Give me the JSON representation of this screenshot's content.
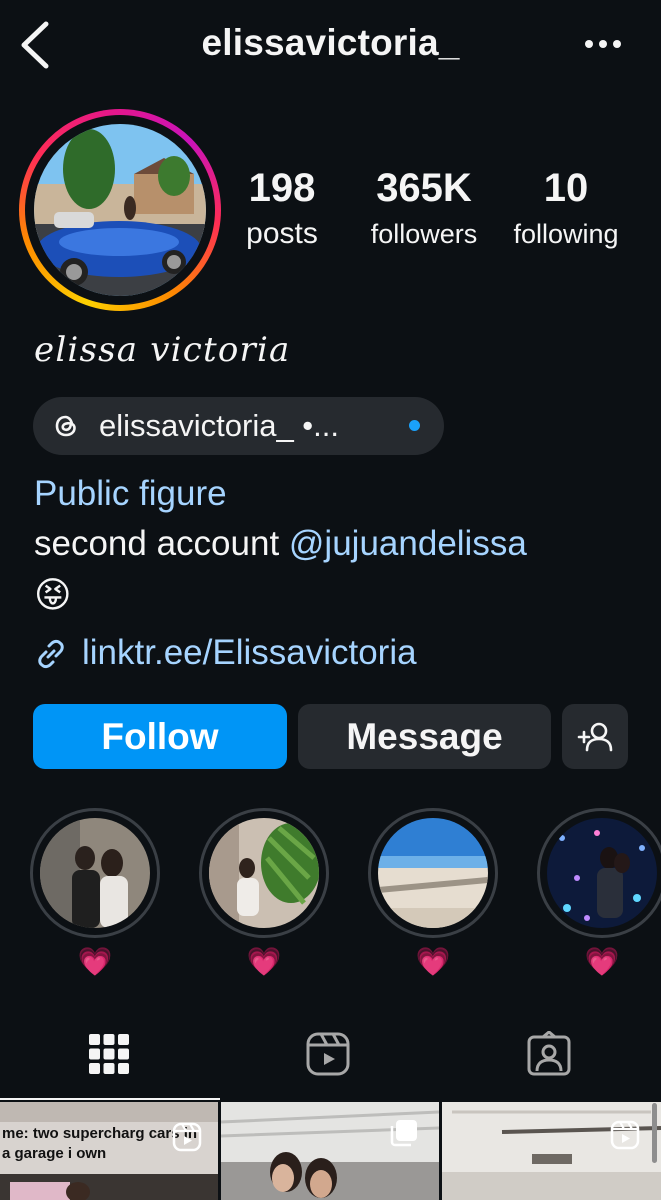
{
  "header": {
    "username": "elissavictoria_",
    "back_icon": "chevron-left-icon",
    "more_icon": "more-horizontal-icon"
  },
  "profile": {
    "avatar_description_icon": "profile-photo",
    "stats": [
      {
        "value": "198",
        "label": "posts"
      },
      {
        "value": "365K",
        "label": "followers"
      },
      {
        "value": "10",
        "label": "following"
      }
    ],
    "display_name": "𝑒𝑙𝑖𝑠𝑠𝑎 𝑣𝑖𝑐𝑡𝑜𝑟𝑖𝑎",
    "threads_badge": {
      "icon": "threads-icon",
      "text": "elissavictoria_ •..."
    },
    "category": "Public figure",
    "bio_prefix": "second account ",
    "bio_mention": "@jujuandelissa",
    "bio_emoji": "😝",
    "link": {
      "icon": "link-icon",
      "text": "linktr.ee/Elissavictoria"
    }
  },
  "actions": {
    "follow": "Follow",
    "message": "Message",
    "add_user_icon": "add-user-icon"
  },
  "highlights": [
    {
      "label": "💗"
    },
    {
      "label": "💗"
    },
    {
      "label": "💗"
    },
    {
      "label": "💗"
    }
  ],
  "tabs": [
    {
      "icon": "grid-icon",
      "selected": true
    },
    {
      "icon": "reels-icon",
      "selected": false
    },
    {
      "icon": "tagged-icon",
      "selected": false
    }
  ],
  "grid": {
    "first_caption": "me: two supercharg cars in a garage i own"
  },
  "colors": {
    "background": "#0c1014",
    "accent_blue": "#0095f6",
    "link_blue": "#a6d4ff",
    "button_gray": "#262a2f"
  }
}
